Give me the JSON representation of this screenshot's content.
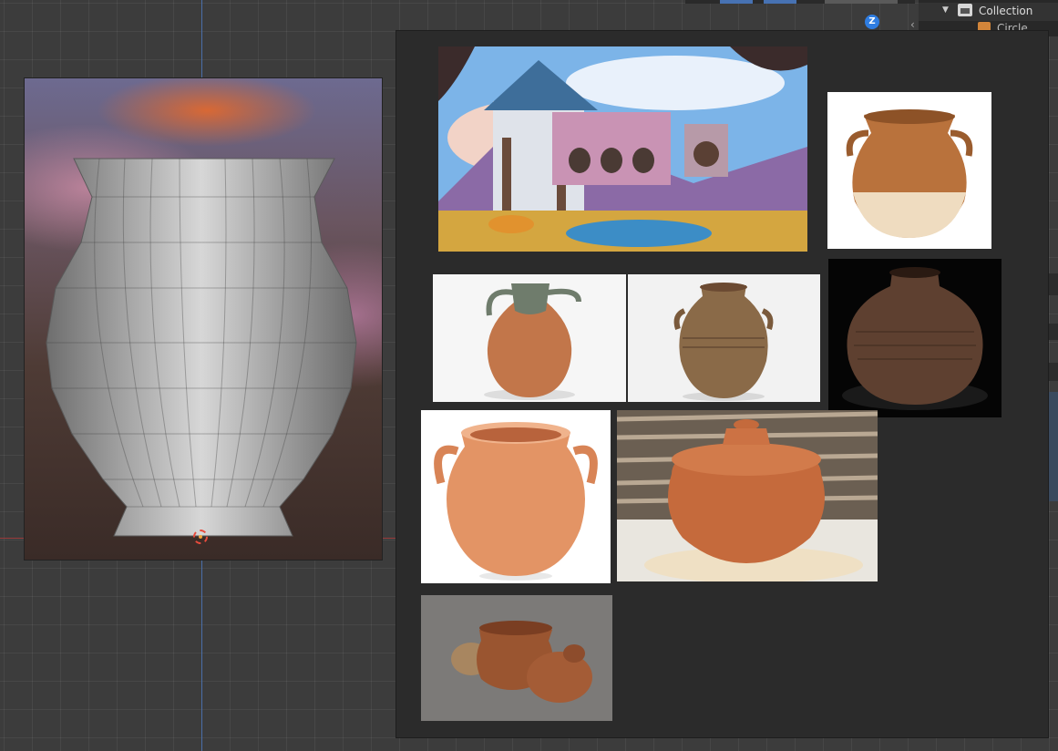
{
  "outliner": {
    "collection_label": "Collection",
    "object_label": "Circle"
  },
  "gizmo": {
    "axis_label": "Z"
  },
  "board": {
    "images": [
      "game-art-village-scene",
      "white-base-clay-jar",
      "green-glaze-jug",
      "ribbed-old-pot",
      "dark-textured-pot",
      "terracotta-two-handle-pot",
      "lidded-pot-on-cloth",
      "small-pot-with-lid"
    ]
  },
  "colors": {
    "viewport_bg": "#3c3c3c",
    "board_bg": "#2b2b2b",
    "terracotta": "#d97a4a",
    "accent_blue": "#2f7de1"
  }
}
